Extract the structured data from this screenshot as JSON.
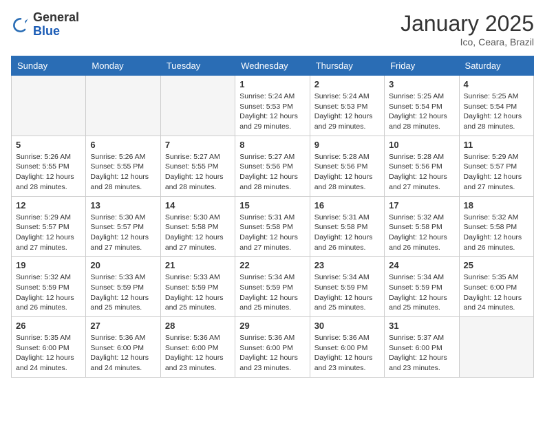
{
  "header": {
    "logo_general": "General",
    "logo_blue": "Blue",
    "month_title": "January 2025",
    "location": "Ico, Ceara, Brazil"
  },
  "weekdays": [
    "Sunday",
    "Monday",
    "Tuesday",
    "Wednesday",
    "Thursday",
    "Friday",
    "Saturday"
  ],
  "weeks": [
    [
      {
        "day": "",
        "empty": true
      },
      {
        "day": "",
        "empty": true
      },
      {
        "day": "",
        "empty": true
      },
      {
        "day": "1",
        "sunrise": "Sunrise: 5:24 AM",
        "sunset": "Sunset: 5:53 PM",
        "daylight": "Daylight: 12 hours and 29 minutes."
      },
      {
        "day": "2",
        "sunrise": "Sunrise: 5:24 AM",
        "sunset": "Sunset: 5:53 PM",
        "daylight": "Daylight: 12 hours and 29 minutes."
      },
      {
        "day": "3",
        "sunrise": "Sunrise: 5:25 AM",
        "sunset": "Sunset: 5:54 PM",
        "daylight": "Daylight: 12 hours and 28 minutes."
      },
      {
        "day": "4",
        "sunrise": "Sunrise: 5:25 AM",
        "sunset": "Sunset: 5:54 PM",
        "daylight": "Daylight: 12 hours and 28 minutes."
      }
    ],
    [
      {
        "day": "5",
        "sunrise": "Sunrise: 5:26 AM",
        "sunset": "Sunset: 5:55 PM",
        "daylight": "Daylight: 12 hours and 28 minutes."
      },
      {
        "day": "6",
        "sunrise": "Sunrise: 5:26 AM",
        "sunset": "Sunset: 5:55 PM",
        "daylight": "Daylight: 12 hours and 28 minutes."
      },
      {
        "day": "7",
        "sunrise": "Sunrise: 5:27 AM",
        "sunset": "Sunset: 5:55 PM",
        "daylight": "Daylight: 12 hours and 28 minutes."
      },
      {
        "day": "8",
        "sunrise": "Sunrise: 5:27 AM",
        "sunset": "Sunset: 5:56 PM",
        "daylight": "Daylight: 12 hours and 28 minutes."
      },
      {
        "day": "9",
        "sunrise": "Sunrise: 5:28 AM",
        "sunset": "Sunset: 5:56 PM",
        "daylight": "Daylight: 12 hours and 28 minutes."
      },
      {
        "day": "10",
        "sunrise": "Sunrise: 5:28 AM",
        "sunset": "Sunset: 5:56 PM",
        "daylight": "Daylight: 12 hours and 27 minutes."
      },
      {
        "day": "11",
        "sunrise": "Sunrise: 5:29 AM",
        "sunset": "Sunset: 5:57 PM",
        "daylight": "Daylight: 12 hours and 27 minutes."
      }
    ],
    [
      {
        "day": "12",
        "sunrise": "Sunrise: 5:29 AM",
        "sunset": "Sunset: 5:57 PM",
        "daylight": "Daylight: 12 hours and 27 minutes."
      },
      {
        "day": "13",
        "sunrise": "Sunrise: 5:30 AM",
        "sunset": "Sunset: 5:57 PM",
        "daylight": "Daylight: 12 hours and 27 minutes."
      },
      {
        "day": "14",
        "sunrise": "Sunrise: 5:30 AM",
        "sunset": "Sunset: 5:58 PM",
        "daylight": "Daylight: 12 hours and 27 minutes."
      },
      {
        "day": "15",
        "sunrise": "Sunrise: 5:31 AM",
        "sunset": "Sunset: 5:58 PM",
        "daylight": "Daylight: 12 hours and 27 minutes."
      },
      {
        "day": "16",
        "sunrise": "Sunrise: 5:31 AM",
        "sunset": "Sunset: 5:58 PM",
        "daylight": "Daylight: 12 hours and 26 minutes."
      },
      {
        "day": "17",
        "sunrise": "Sunrise: 5:32 AM",
        "sunset": "Sunset: 5:58 PM",
        "daylight": "Daylight: 12 hours and 26 minutes."
      },
      {
        "day": "18",
        "sunrise": "Sunrise: 5:32 AM",
        "sunset": "Sunset: 5:58 PM",
        "daylight": "Daylight: 12 hours and 26 minutes."
      }
    ],
    [
      {
        "day": "19",
        "sunrise": "Sunrise: 5:32 AM",
        "sunset": "Sunset: 5:59 PM",
        "daylight": "Daylight: 12 hours and 26 minutes."
      },
      {
        "day": "20",
        "sunrise": "Sunrise: 5:33 AM",
        "sunset": "Sunset: 5:59 PM",
        "daylight": "Daylight: 12 hours and 25 minutes."
      },
      {
        "day": "21",
        "sunrise": "Sunrise: 5:33 AM",
        "sunset": "Sunset: 5:59 PM",
        "daylight": "Daylight: 12 hours and 25 minutes."
      },
      {
        "day": "22",
        "sunrise": "Sunrise: 5:34 AM",
        "sunset": "Sunset: 5:59 PM",
        "daylight": "Daylight: 12 hours and 25 minutes."
      },
      {
        "day": "23",
        "sunrise": "Sunrise: 5:34 AM",
        "sunset": "Sunset: 5:59 PM",
        "daylight": "Daylight: 12 hours and 25 minutes."
      },
      {
        "day": "24",
        "sunrise": "Sunrise: 5:34 AM",
        "sunset": "Sunset: 5:59 PM",
        "daylight": "Daylight: 12 hours and 25 minutes."
      },
      {
        "day": "25",
        "sunrise": "Sunrise: 5:35 AM",
        "sunset": "Sunset: 6:00 PM",
        "daylight": "Daylight: 12 hours and 24 minutes."
      }
    ],
    [
      {
        "day": "26",
        "sunrise": "Sunrise: 5:35 AM",
        "sunset": "Sunset: 6:00 PM",
        "daylight": "Daylight: 12 hours and 24 minutes."
      },
      {
        "day": "27",
        "sunrise": "Sunrise: 5:36 AM",
        "sunset": "Sunset: 6:00 PM",
        "daylight": "Daylight: 12 hours and 24 minutes."
      },
      {
        "day": "28",
        "sunrise": "Sunrise: 5:36 AM",
        "sunset": "Sunset: 6:00 PM",
        "daylight": "Daylight: 12 hours and 23 minutes."
      },
      {
        "day": "29",
        "sunrise": "Sunrise: 5:36 AM",
        "sunset": "Sunset: 6:00 PM",
        "daylight": "Daylight: 12 hours and 23 minutes."
      },
      {
        "day": "30",
        "sunrise": "Sunrise: 5:36 AM",
        "sunset": "Sunset: 6:00 PM",
        "daylight": "Daylight: 12 hours and 23 minutes."
      },
      {
        "day": "31",
        "sunrise": "Sunrise: 5:37 AM",
        "sunset": "Sunset: 6:00 PM",
        "daylight": "Daylight: 12 hours and 23 minutes."
      },
      {
        "day": "",
        "empty": true
      }
    ]
  ]
}
